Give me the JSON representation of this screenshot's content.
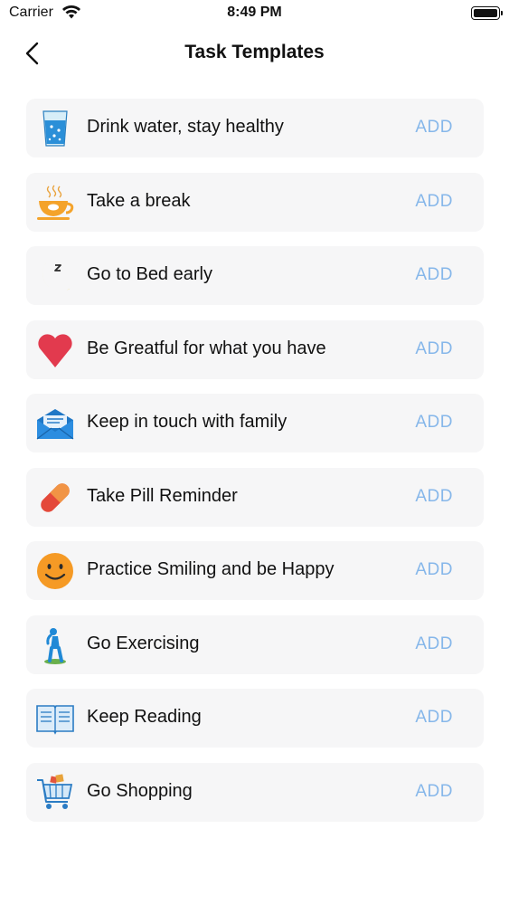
{
  "status": {
    "carrier": "Carrier",
    "time": "8:49 PM",
    "battery_level": 1.0
  },
  "nav": {
    "title": "Task Templates",
    "back_icon": "chevron-left-icon"
  },
  "add_label": "ADD",
  "templates": [
    {
      "label": "Drink water, stay healthy",
      "icon": "water-glass-icon"
    },
    {
      "label": "Take a break",
      "icon": "coffee-cup-icon"
    },
    {
      "label": "Go to Bed early",
      "icon": "moon-icon"
    },
    {
      "label": "Be Greatful for what you have",
      "icon": "heart-icon"
    },
    {
      "label": "Keep in touch with family",
      "icon": "mail-icon"
    },
    {
      "label": "Take Pill Reminder",
      "icon": "pill-icon"
    },
    {
      "label": "Practice Smiling and be Happy",
      "icon": "smiley-icon"
    },
    {
      "label": "Go Exercising",
      "icon": "exercise-icon"
    },
    {
      "label": "Keep Reading",
      "icon": "book-icon"
    },
    {
      "label": "Go Shopping",
      "icon": "shopping-cart-icon"
    }
  ]
}
